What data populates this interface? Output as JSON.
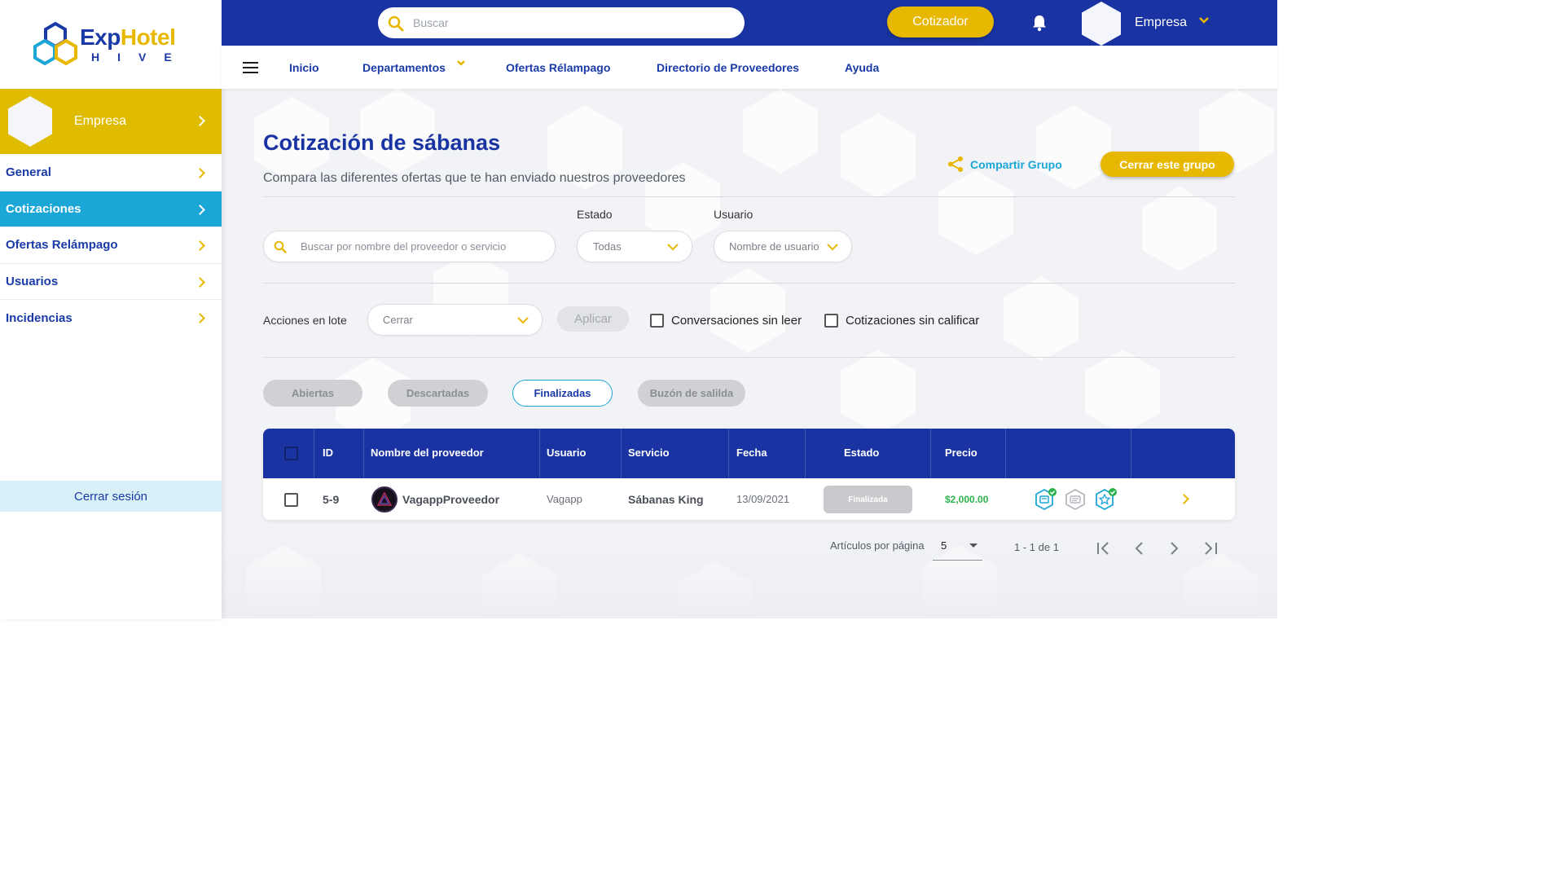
{
  "brand": {
    "logo_exp": "Exp",
    "logo_hotel": "Hotel",
    "logo_hive": "HIVE"
  },
  "topbar": {
    "search_placeholder": "Buscar",
    "cotizador_label": "Cotizador",
    "company_name": "Empresa"
  },
  "menubar": {
    "items": [
      "Inicio",
      "Departamentos",
      "Ofertas Rélampago",
      "Directorio de Proveedores",
      "Ayuda"
    ]
  },
  "sidebar": {
    "company_name": "Empresa",
    "items": [
      {
        "label": "General",
        "active": false
      },
      {
        "label": "Cotizaciones",
        "active": true
      },
      {
        "label": "Ofertas Relámpago",
        "active": false
      },
      {
        "label": "Usuarios",
        "active": false
      },
      {
        "label": "Incidencias",
        "active": false
      }
    ],
    "logout_label": "Cerrar sesión"
  },
  "page": {
    "title": "Cotización de sábanas",
    "subtitle": "Compara las diferentes ofertas que te han enviado nuestros proveedores",
    "share_label": "Compartir Grupo",
    "close_group_label": "Cerrar este grupo"
  },
  "filters": {
    "search_placeholder": "Buscar por nombre del proveedor o servicio",
    "estado_label": "Estado",
    "estado_value": "Todas",
    "usuario_label": "Usuario",
    "usuario_placeholder": "Nombre de usuario"
  },
  "batch": {
    "label": "Acciones en lote",
    "select_value": "Cerrar",
    "apply_label": "Aplicar",
    "unread_label": "Conversaciones sin leer",
    "unrated_label": "Cotizaciones sin calificar"
  },
  "tabs": [
    {
      "label": "Abiertas",
      "active": false
    },
    {
      "label": "Descartadas",
      "active": false
    },
    {
      "label": "Finalizadas",
      "active": true
    },
    {
      "label": "Buzón de salilda",
      "active": false
    }
  ],
  "table": {
    "headers": [
      "ID",
      "Nombre del proveedor",
      "Usuario",
      "Servicio",
      "Fecha",
      "Estado",
      "Precio"
    ],
    "rows": [
      {
        "id": "5-9",
        "provider": "VagappProveedor",
        "user": "Vagapp",
        "service": "Sábanas King",
        "date": "13/09/2021",
        "status": "Finalizada",
        "price": "$2,000.00",
        "icons": [
          "quote-check-icon",
          "message-icon",
          "star-rating-icon"
        ]
      }
    ]
  },
  "pagination": {
    "per_page_label": "Artículos por página",
    "per_page_value": "5",
    "range": "1 - 1 de 1"
  },
  "colors": {
    "primary_blue": "#1a33a3",
    "accent_yellow": "#e8b800",
    "cyan": "#1ba6d8",
    "price_green": "#2bb24c"
  }
}
